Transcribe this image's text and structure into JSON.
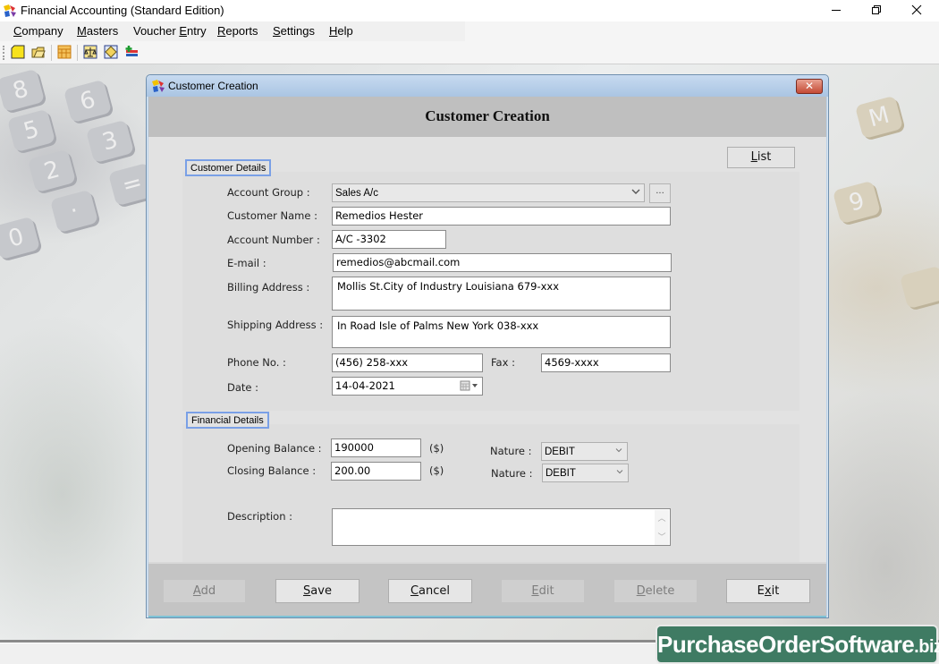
{
  "app": {
    "title": "Financial Accounting (Standard Edition)",
    "window_controls": [
      "minimize",
      "restore",
      "close"
    ]
  },
  "menu": [
    {
      "label": "Company",
      "mnemonic": "C"
    },
    {
      "label": "Masters",
      "mnemonic": "M"
    },
    {
      "label": "Voucher Entry",
      "mnemonic": "E"
    },
    {
      "label": "Reports",
      "mnemonic": "R"
    },
    {
      "label": "Settings",
      "mnemonic": "S"
    },
    {
      "label": "Help",
      "mnemonic": "H"
    }
  ],
  "toolbar": {
    "icons": [
      "new-file-icon",
      "open-folder-icon",
      "ledger-grid-icon",
      "balance-scale-icon",
      "voucher-icon",
      "add-entry-icon"
    ]
  },
  "dialog": {
    "title": "Customer Creation",
    "heading": "Customer Creation",
    "list_button": "List",
    "customer_details": {
      "group_label": "Customer Details",
      "account_group": {
        "label": "Account Group :",
        "value": "Sales A/c",
        "more_button": "..."
      },
      "customer_name": {
        "label": "Customer Name :",
        "value": "Remedios Hester"
      },
      "account_number": {
        "label": "Account Number :",
        "value": "A/C -3302"
      },
      "email": {
        "label": "E-mail :",
        "value": "remedios@abcmail.com"
      },
      "billing_address": {
        "label": "Billing Address :",
        "value": "Mollis St.City of Industry Louisiana 679-xxx"
      },
      "shipping_address": {
        "label": "Shipping Address :",
        "value": "In Road Isle of Palms New York 038-xxx"
      },
      "phone": {
        "label": "Phone No. :",
        "value": "(456) 258-xxx"
      },
      "fax": {
        "label": "Fax :",
        "value": "4569-xxxx"
      },
      "date": {
        "label": "Date :",
        "value": "14-04-2021"
      }
    },
    "financial_details": {
      "group_label": "Financial Details",
      "opening_balance": {
        "label": "Opening Balance :",
        "value": "190000",
        "unit": "($)"
      },
      "closing_balance": {
        "label": "Closing Balance :",
        "value": "200.00",
        "unit": "($)"
      },
      "opening_nature": {
        "label": "Nature :",
        "value": "DEBIT"
      },
      "closing_nature": {
        "label": "Nature :",
        "value": "DEBIT"
      }
    },
    "description": {
      "label": "Description :",
      "value": ""
    },
    "buttons": [
      {
        "label": "Add",
        "mnemonic": "A",
        "enabled": false
      },
      {
        "label": "Save",
        "mnemonic": "S",
        "enabled": true
      },
      {
        "label": "Cancel",
        "mnemonic": "C",
        "enabled": true
      },
      {
        "label": "Edit",
        "mnemonic": "E",
        "enabled": false
      },
      {
        "label": "Delete",
        "mnemonic": "D",
        "enabled": false
      },
      {
        "label": "Exit",
        "mnemonic": "x",
        "enabled": true
      }
    ]
  },
  "watermark": {
    "main": "PurchaseOrderSoftware",
    "suffix": ".biz"
  },
  "colors": {
    "dialog_body": "#e2e2e2",
    "header_band": "#bfbfbf",
    "group_border": "#7aa0e6",
    "watermark_bg": "#3f7b63",
    "close_button": "#c44a35"
  }
}
